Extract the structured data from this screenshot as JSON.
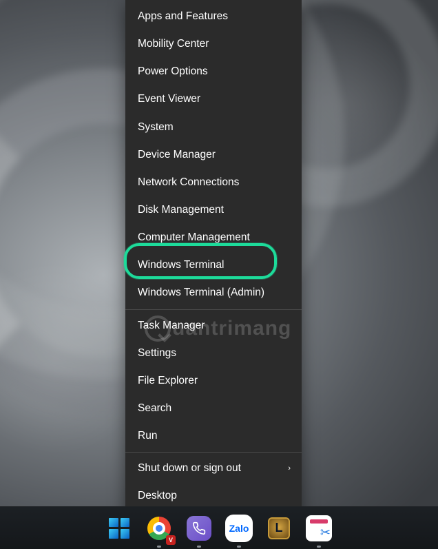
{
  "menu": {
    "apps_features": "Apps and Features",
    "mobility_center": "Mobility Center",
    "power_options": "Power Options",
    "event_viewer": "Event Viewer",
    "system": "System",
    "device_manager": "Device Manager",
    "network_connections": "Network Connections",
    "disk_management": "Disk Management",
    "computer_management": "Computer Management",
    "windows_terminal": "Windows Terminal",
    "windows_terminal_admin": "Windows Terminal (Admin)",
    "task_manager": "Task Manager",
    "settings": "Settings",
    "file_explorer": "File Explorer",
    "search": "Search",
    "run": "Run",
    "shut_down": "Shut down or sign out",
    "desktop": "Desktop"
  },
  "watermark": "uantrimang",
  "taskbar": {
    "zalo_label": "Zalo",
    "lol_label": "L",
    "chrome_badge": "V"
  },
  "highlight": {
    "color": "#1ddb9a"
  }
}
